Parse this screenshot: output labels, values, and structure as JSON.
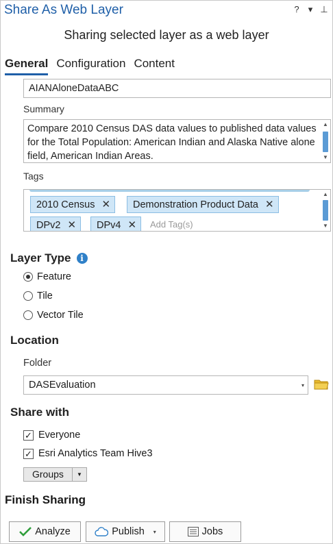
{
  "window": {
    "title": "Share As Web Layer",
    "help_glyph": "?",
    "menu_glyph": "▾",
    "pin_glyph": "⊥"
  },
  "subtitle": "Sharing selected layer as a web layer",
  "tabs": [
    {
      "label": "General",
      "active": true
    },
    {
      "label": "Configuration",
      "active": false
    },
    {
      "label": "Content",
      "active": false
    }
  ],
  "general": {
    "name_value": "AIANAloneDataABC",
    "summary_label": "Summary",
    "summary_value": "Compare 2010 Census DAS data values to published data values for the Total Population: American Indian and Alaska Native alone field, American Indian Areas.",
    "tags_label": "Tags",
    "tags": [
      "2010 Census",
      "Demonstration Product Data",
      "DPv2",
      "DPv4"
    ],
    "tags_remove_glyph": "✕",
    "add_tag_placeholder": "Add Tag(s)",
    "scroll_up_glyph": "▲",
    "scroll_down_glyph": "▼"
  },
  "layer_type": {
    "heading": "Layer Type",
    "info_glyph": "i",
    "options": [
      {
        "label": "Feature",
        "selected": true
      },
      {
        "label": "Tile",
        "selected": false
      },
      {
        "label": "Vector Tile",
        "selected": false
      }
    ]
  },
  "location": {
    "heading": "Location",
    "folder_label": "Folder",
    "folder_value": "DASEvaluation",
    "caret_glyph": "▾"
  },
  "share_with": {
    "heading": "Share with",
    "check_glyph": "✓",
    "options": [
      {
        "label": "Everyone",
        "checked": true
      },
      {
        "label": "Esri Analytics Team Hive3",
        "checked": true
      }
    ],
    "groups_label": "Groups",
    "groups_caret": "▼"
  },
  "finish": {
    "heading": "Finish Sharing",
    "analyze_label": "Analyze",
    "publish_label": "Publish",
    "publish_caret": "▾",
    "jobs_label": "Jobs"
  },
  "colors": {
    "accent": "#1f5fa8",
    "tag_fill": "#cfe6f7",
    "scroll_thumb": "#5b9bd5",
    "folder": "#e8b92e",
    "check_green": "#2f9e3b"
  }
}
